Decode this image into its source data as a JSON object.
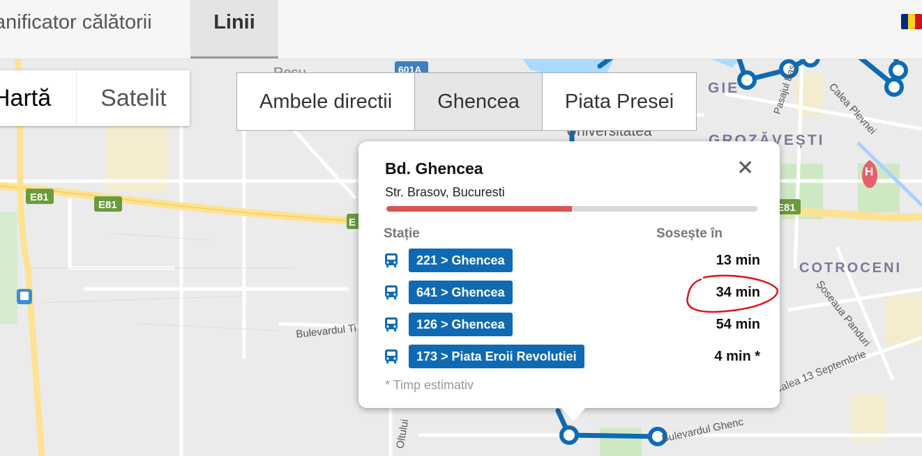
{
  "topbar": {
    "tab_planner": "anificator călătorii",
    "tab_linii": "Linii"
  },
  "flag_colors": [
    "#002b7f",
    "#fcd116",
    "#ce1126"
  ],
  "map": {
    "labels": {
      "e81_1": "E81",
      "e81_2": "E81",
      "e81_3": "E81",
      "e_partial": "E",
      "r601a": "601A",
      "rosu": "Rosu",
      "gie": "GIE",
      "grozavesti": "GROZĂVEȘTI",
      "universitatea": "Universitatea",
      "cotroceni": "COTROCENI",
      "pasajul": "Pasajul Bas",
      "calea_plevnei": "Calea Plevnei",
      "soseaua_panduri": "Șoseaua Panduri",
      "calea_13": "Calea 13 Septembrie",
      "bd_timisoara": "Bulevardul Ti",
      "bd_ghencea_map": "Bulevardul Ghenc",
      "str_oltului": "Oltului",
      "hospital": "H"
    },
    "route_color": "#0f6ab4"
  },
  "map_type": {
    "harta": "Hartă",
    "satelit": "Satelit"
  },
  "directions": {
    "both": "Ambele directii",
    "ghencea": "Ghencea",
    "piata_presei": "Piata Presei"
  },
  "popup": {
    "title": "Bd. Ghencea",
    "address": "Str. Brasov, Bucuresti",
    "progress": 0.5,
    "col_statie": "Stație",
    "col_soseste": "Sosește în",
    "rows": [
      {
        "line": "221 > Ghencea",
        "time": "13 min"
      },
      {
        "line": "641 > Ghencea",
        "time": "34 min"
      },
      {
        "line": "126 > Ghencea",
        "time": "54 min"
      },
      {
        "line": "173 > Piata Eroii Revolutiei",
        "time": "4 min *"
      }
    ],
    "footnote": "* Timp estimativ",
    "close_icon": "close-icon",
    "bus_icon": "bus-icon"
  },
  "colors": {
    "badge": "#0f6ab4",
    "progress_fill": "#d9534f",
    "annotation": "#e0101a"
  }
}
